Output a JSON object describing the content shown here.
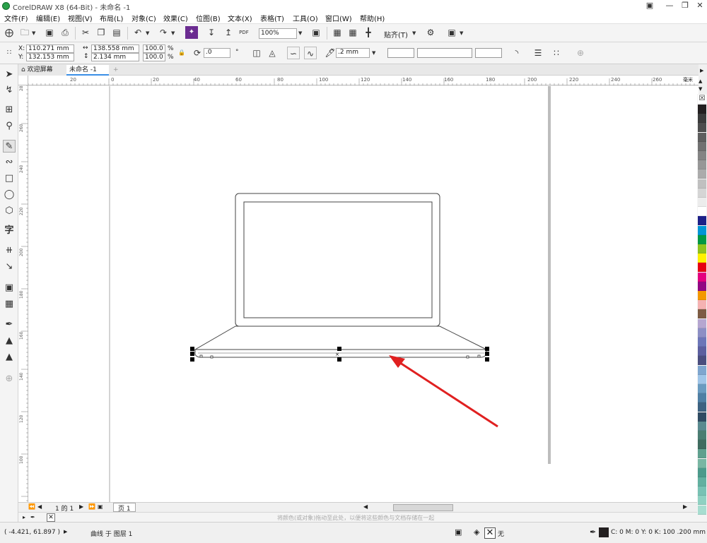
{
  "window": {
    "title": "CorelDRAW X8 (64-Bit) - 未命名 -1"
  },
  "menu": [
    "文件(F)",
    "编辑(E)",
    "视图(V)",
    "布局(L)",
    "对象(C)",
    "效果(C)",
    "位图(B)",
    "文本(X)",
    "表格(T)",
    "工具(O)",
    "窗口(W)",
    "帮助(H)"
  ],
  "toolbar": {
    "zoom": "100%",
    "snap_label": "贴齐(T)",
    "pdf": "PDF"
  },
  "props": {
    "x_label": "X:",
    "x": "110.271 mm",
    "y_label": "Y:",
    "y": "132.153 mm",
    "w": "138.558 mm",
    "h": "2.134 mm",
    "sx": "100.0",
    "sy": "100.0",
    "pct1": "%",
    "pct2": "%",
    "angle": ".0",
    "outline": ".2 mm"
  },
  "tabs": {
    "welcome": "欢迎屏幕",
    "doc": "未命名 -1"
  },
  "ruler": {
    "h_ticks": [
      "20",
      "0",
      "20",
      "40",
      "60",
      "80",
      "100",
      "120",
      "140",
      "160",
      "180",
      "200",
      "220",
      "240",
      "260"
    ],
    "unit": "毫米",
    "v_ticks": [
      "280",
      "260",
      "240",
      "220",
      "200",
      "180",
      "160",
      "140",
      "120",
      "100",
      "80"
    ]
  },
  "pagenav": {
    "page_count": "1 的 1",
    "page_tab": "页 1"
  },
  "hint": "将颜色(或对象)拖动至此处，以便将这些颜色与文档存储在一起",
  "status": {
    "coords": "( -4.421, 61.897 )",
    "object": "曲线 于 图层 1",
    "fill_none": "无",
    "color_info": "C: 0 M: 0 Y: 0 K: 100  .200 mm"
  },
  "colors": {
    "accent": "#3a8ee6",
    "arrow": "#e02020",
    "palette": [
      "#231f20",
      "#3b3b3b",
      "#4d4d4d",
      "#5e5e5e",
      "#717171",
      "#848484",
      "#979797",
      "#ababab",
      "#c0c0c0",
      "#d5d5d5",
      "#ececec",
      "#ffffff",
      "#1d2088",
      "#0096d6",
      "#009944",
      "#8fc31f",
      "#fff100",
      "#e60012",
      "#e4007f",
      "#920783",
      "#f39800",
      "#f5b2b2",
      "#7d5b43",
      "#b5a6d0",
      "#8c8fc5",
      "#6c76b8",
      "#5c5f9f",
      "#4a4d7e",
      "#7fa6cf",
      "#9fc5e8",
      "#6a9bc0",
      "#4f7fa4",
      "#3d6281",
      "#2f4b63",
      "#5a8a8f",
      "#4a7d72",
      "#3f6b5f",
      "#5fa08e",
      "#79b6a3",
      "#4c9a8b",
      "#62b0a0",
      "#78c2b4",
      "#8fd1c2",
      "#a7ddd0"
    ]
  }
}
